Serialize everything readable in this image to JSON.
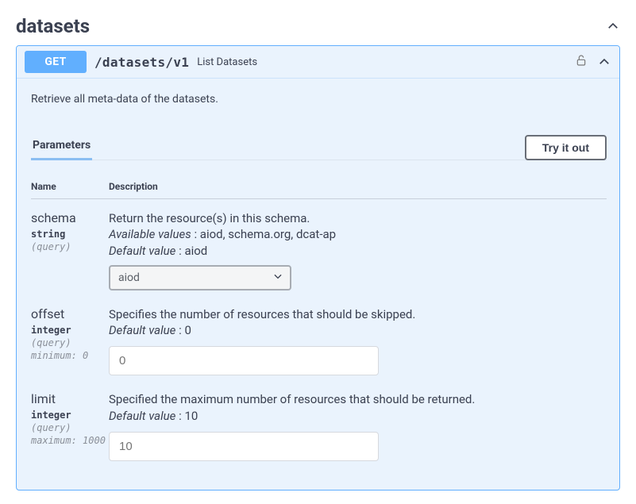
{
  "section": {
    "title": "datasets"
  },
  "op": {
    "method": "GET",
    "path": "/datasets/v1",
    "summary": "List Datasets",
    "description": "Retrieve all meta-data of the datasets."
  },
  "tabs": {
    "parameters": "Parameters"
  },
  "buttons": {
    "try": "Try it out"
  },
  "table": {
    "name_header": "Name",
    "desc_header": "Description"
  },
  "params": {
    "schema": {
      "name": "schema",
      "type": "string",
      "in": "(query)",
      "desc": "Return the resource(s) in this schema.",
      "avail_label": "Available values",
      "avail_values": " : aiod, schema.org, dcat-ap",
      "default_label": "Default value",
      "default_value": " : aiod",
      "selected": "aiod"
    },
    "offset": {
      "name": "offset",
      "type": "integer",
      "in": "(query)",
      "constraint": "minimum: 0",
      "desc": "Specifies the number of resources that should be skipped.",
      "default_label": "Default value",
      "default_value": " : 0",
      "placeholder": "0"
    },
    "limit": {
      "name": "limit",
      "type": "integer",
      "in": "(query)",
      "constraint": "maximum: 1000",
      "desc": "Specified the maximum number of resources that should be returned.",
      "default_label": "Default value",
      "default_value": " : 10",
      "placeholder": "10"
    }
  }
}
